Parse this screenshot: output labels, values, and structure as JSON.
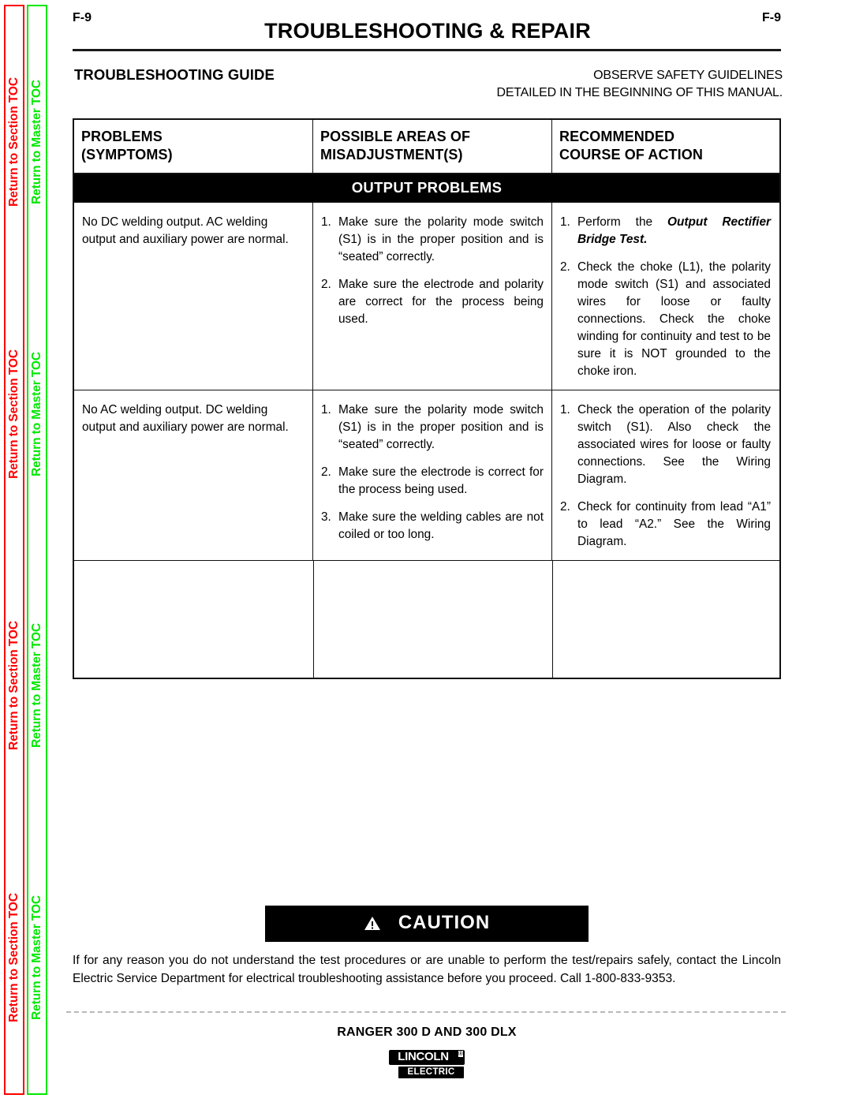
{
  "sidebar": {
    "section_toc_label": "Return to Section TOC",
    "master_toc_label": "Return to Master TOC",
    "section_color": "#fe0000",
    "master_color": "#00e800",
    "repeat_count": 4
  },
  "header": {
    "folio_left": "F-9",
    "folio_right": "F-9",
    "title": "TROUBLESHOOTING & REPAIR"
  },
  "guide": {
    "heading": "TROUBLESHOOTING GUIDE",
    "safety_line1": "OBSERVE SAFETY GUIDELINES",
    "safety_line2": "DETAILED IN THE BEGINNING OF THIS MANUAL."
  },
  "table": {
    "headers": {
      "col1_line1": "PROBLEMS",
      "col1_line2": "(SYMPTOMS)",
      "col2_line1": "POSSIBLE AREAS OF",
      "col2_line2": "MISADJUSTMENT(S)",
      "col3_line1": "RECOMMENDED",
      "col3_line2": "COURSE OF ACTION"
    },
    "section_band": "OUTPUT PROBLEMS",
    "rows": [
      {
        "symptom": "No DC welding output.  AC welding output and auxiliary power are normal.",
        "misadjustments": [
          {
            "num": "1.",
            "text": "Make sure the polarity mode switch (S1) is in the proper position and is “seated” correctly."
          },
          {
            "num": "2.",
            "text": "Make sure the electrode and polarity are correct for the process being used."
          }
        ],
        "actions": [
          {
            "num": "1.",
            "text_before": "Perform the ",
            "emphasis": "Output Rectifier Bridge Test.",
            "text_after": ""
          },
          {
            "num": "2.",
            "text_before": "Check the choke (L1), the polarity mode switch (S1) and associated wires for loose or faulty connections.  Check the choke winding for continuity and test to be sure it is NOT grounded to the choke iron.",
            "emphasis": "",
            "text_after": ""
          }
        ]
      },
      {
        "symptom": "No AC welding output.  DC welding output and auxiliary power are normal.",
        "misadjustments": [
          {
            "num": "1.",
            "text": "Make sure the polarity mode switch (S1) is in the proper position and is “seated” correctly."
          },
          {
            "num": "2.",
            "text": "Make sure the electrode is correct for the process being used."
          },
          {
            "num": "3.",
            "text": "Make sure the welding cables are not coiled or too long."
          }
        ],
        "actions": [
          {
            "num": "1.",
            "text_before": "Check the operation of the polarity switch (S1).  Also check the associated wires for loose or faulty connections.  See the Wiring Diagram.",
            "emphasis": "",
            "text_after": ""
          },
          {
            "num": "2.",
            "text_before": "Check for continuity from lead “A1” to lead “A2.”  See the Wiring Diagram.",
            "emphasis": "",
            "text_after": ""
          }
        ]
      }
    ]
  },
  "caution": {
    "label": "CAUTION",
    "icon": "warning-triangle-icon",
    "body": "If for any reason you do not understand the test procedures or are unable to perform the test/repairs safely, contact the Lincoln Electric Service Department for electrical troubleshooting assistance before you proceed.  Call 1-800-833-9353."
  },
  "footer": {
    "model": "RANGER  300 D AND 300 DLX",
    "logo_top": "LINCOLN",
    "logo_reg": "®",
    "logo_bottom": "ELECTRIC"
  }
}
